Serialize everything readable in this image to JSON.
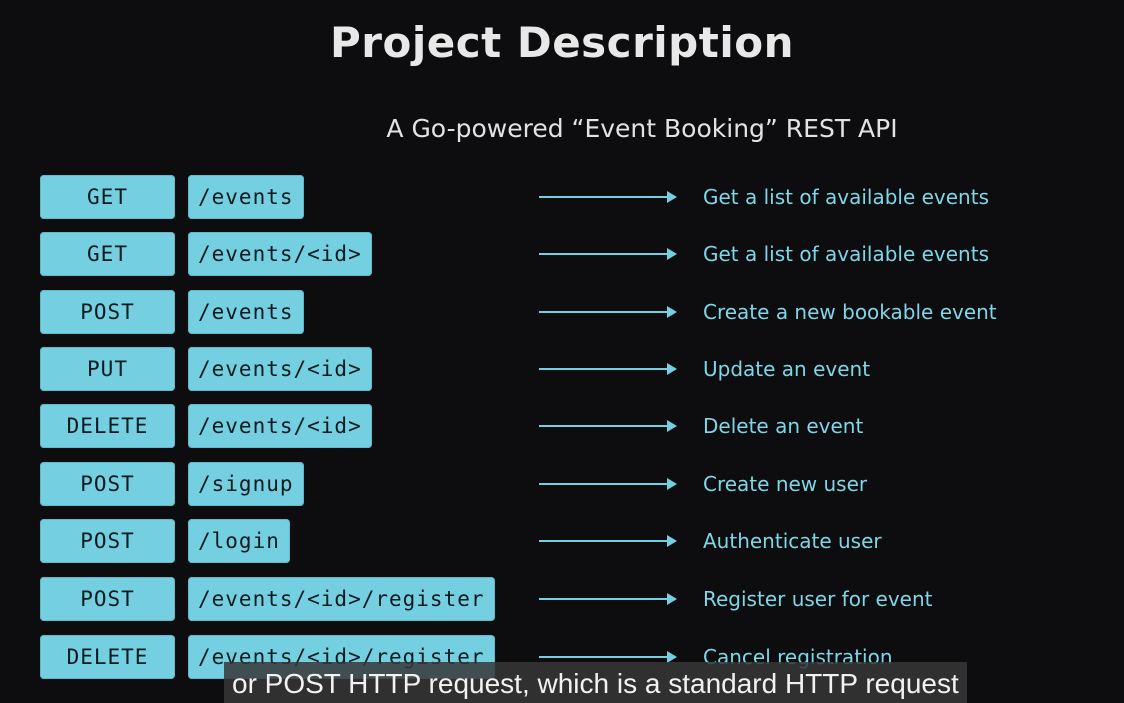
{
  "slide": {
    "title": "Project Description",
    "subtitle": "A Go-powered “Event Booking” REST API"
  },
  "routes": [
    {
      "method": "GET",
      "path": "/events",
      "description": "Get a list of available events"
    },
    {
      "method": "GET",
      "path": "/events/<id>",
      "description": "Get a list of available events"
    },
    {
      "method": "POST",
      "path": "/events",
      "description": "Create a new bookable event"
    },
    {
      "method": "PUT",
      "path": "/events/<id>",
      "description": "Update an event"
    },
    {
      "method": "DELETE",
      "path": "/events/<id>",
      "description": "Delete an event"
    },
    {
      "method": "POST",
      "path": "/signup",
      "description": "Create new user"
    },
    {
      "method": "POST",
      "path": "/login",
      "description": "Authenticate user"
    },
    {
      "method": "POST",
      "path": "/events/<id>/register",
      "description": "Register user for event"
    },
    {
      "method": "DELETE",
      "path": "/events/<id>/register",
      "description": "Cancel registration"
    }
  ],
  "caption": {
    "text": "or POST HTTP request, which is a standard HTTP request"
  },
  "colors": {
    "accent": "#74cfe0",
    "background": "#0d0d0f"
  }
}
